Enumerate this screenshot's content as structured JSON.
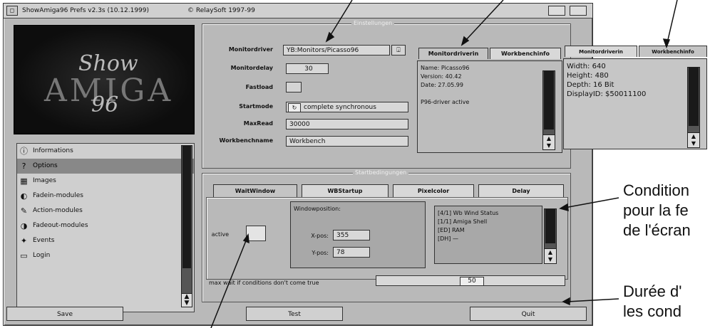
{
  "window": {
    "title": "ShowAmiga96 Prefs v2.3s (10.12.1999)",
    "copyright": "© RelaySoft 1997-99"
  },
  "logo": {
    "line1": "Show",
    "line2": "AMIGA",
    "line3": "96"
  },
  "menu": {
    "items": [
      {
        "label": "Informations",
        "icon": "info-icon"
      },
      {
        "label": "Options",
        "icon": "options-icon",
        "selected": true
      },
      {
        "label": "Images",
        "icon": "images-icon"
      },
      {
        "label": "Fadein-modules",
        "icon": "fadein-icon"
      },
      {
        "label": "Action-modules",
        "icon": "action-icon"
      },
      {
        "label": "Fadeout-modules",
        "icon": "fadeout-icon"
      },
      {
        "label": "Events",
        "icon": "events-icon"
      },
      {
        "label": "Login",
        "icon": "login-icon"
      }
    ]
  },
  "settings": {
    "group_title": "Einstellungen",
    "monitordriver_label": "Monitordriver",
    "monitordriver_value": "YB:Monitors/Picasso96",
    "monitordelay_label": "Monitordelay",
    "monitordelay_value": "30",
    "fastload_label": "Fastload",
    "startmode_label": "Startmode",
    "startmode_value": "complete synchronous",
    "maxread_label": "MaxRead",
    "maxread_value": "30000",
    "workbenchname_label": "Workbenchname",
    "workbenchname_value": "Workbench"
  },
  "driverinfo": {
    "tab1": "Monitordriverin",
    "tab2": "Workbenchinfo",
    "lines": [
      "Name: Picasso96",
      "Version: 40.42",
      "Date: 27.05.99",
      "",
      "P96-driver active"
    ]
  },
  "wbinfo": {
    "tab1": "Monitordriverin",
    "tab2": "Workbenchinfo",
    "lines": [
      "Width: 640",
      "Height: 480",
      "Depth: 16 Bit",
      "DisplayID: $50011100"
    ]
  },
  "conditions": {
    "group_title": "Startbedingungen",
    "tabs": [
      "WaitWindow",
      "WBStartup",
      "Pixelcolor",
      "Delay"
    ],
    "active_label": "active",
    "window_position_label": "Windowposition:",
    "xpos_label": "X-pos:",
    "xpos_value": "355",
    "ypos_label": "Y-pos:",
    "ypos_value": "78",
    "list_lines": [
      "[4/1] Wb  Wind Status",
      "[1/1] Amiga Shell",
      "[ED] RAM",
      "[DH] —"
    ],
    "maxwait_label": "max wait if conditions don't come true",
    "maxwait_value": "50"
  },
  "buttons": {
    "save": "Save",
    "test": "Test",
    "quit": "Quit"
  },
  "annotations": {
    "cond_l1": "Condition",
    "cond_l2": "pour la fe",
    "cond_l3": "de l'écran",
    "dur_l1": "Durée d'",
    "dur_l2": "les cond"
  }
}
